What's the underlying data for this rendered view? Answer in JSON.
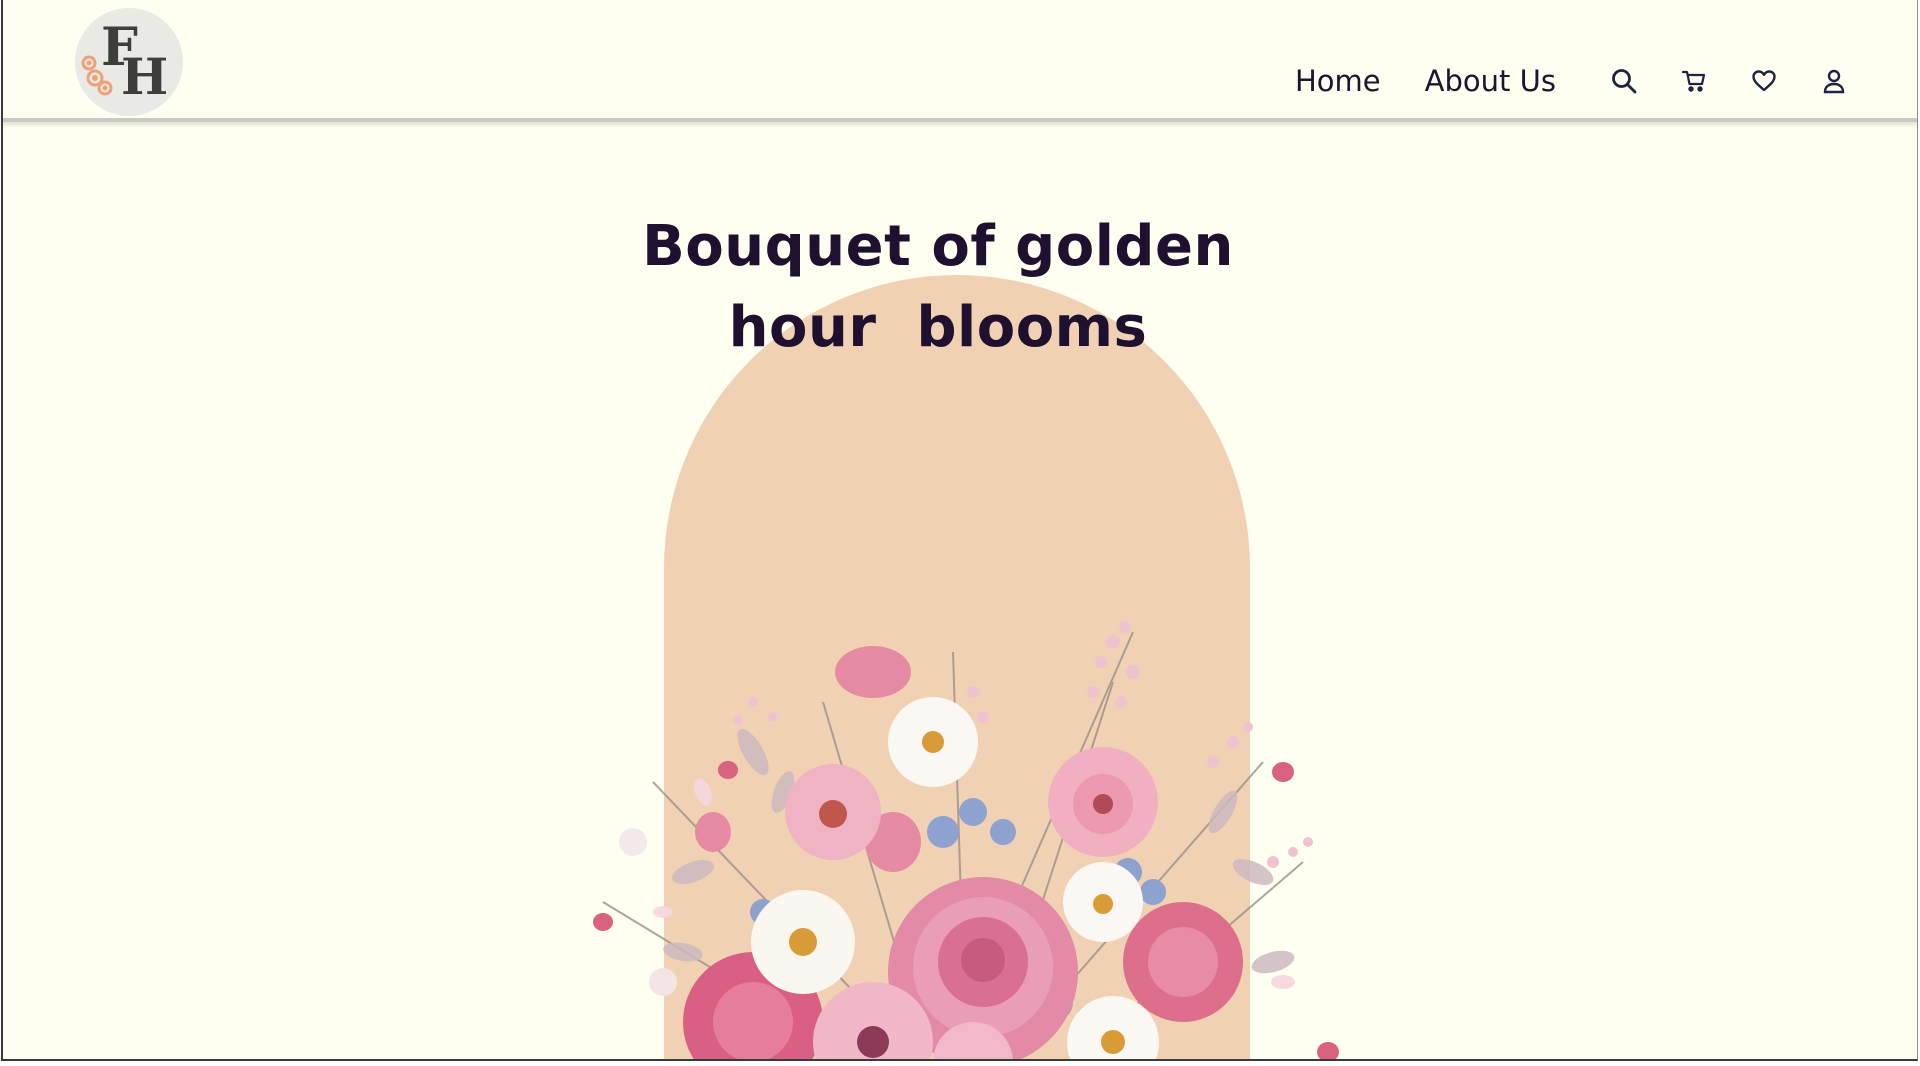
{
  "brand": {
    "logo_text_top": "F",
    "logo_text_bottom": "H"
  },
  "nav": {
    "links": [
      {
        "label": "Home"
      },
      {
        "label": "About Us"
      }
    ],
    "icons": [
      "search-icon",
      "cart-icon",
      "heart-icon",
      "user-icon"
    ]
  },
  "hero": {
    "title_line1": "Bouquet of golden",
    "title_line2": "hour  blooms",
    "arch_color": "#f1d1b3"
  },
  "colors": {
    "background": "#fefef1",
    "text": "#1e102e",
    "navbar_border": "#c9c9c2"
  }
}
